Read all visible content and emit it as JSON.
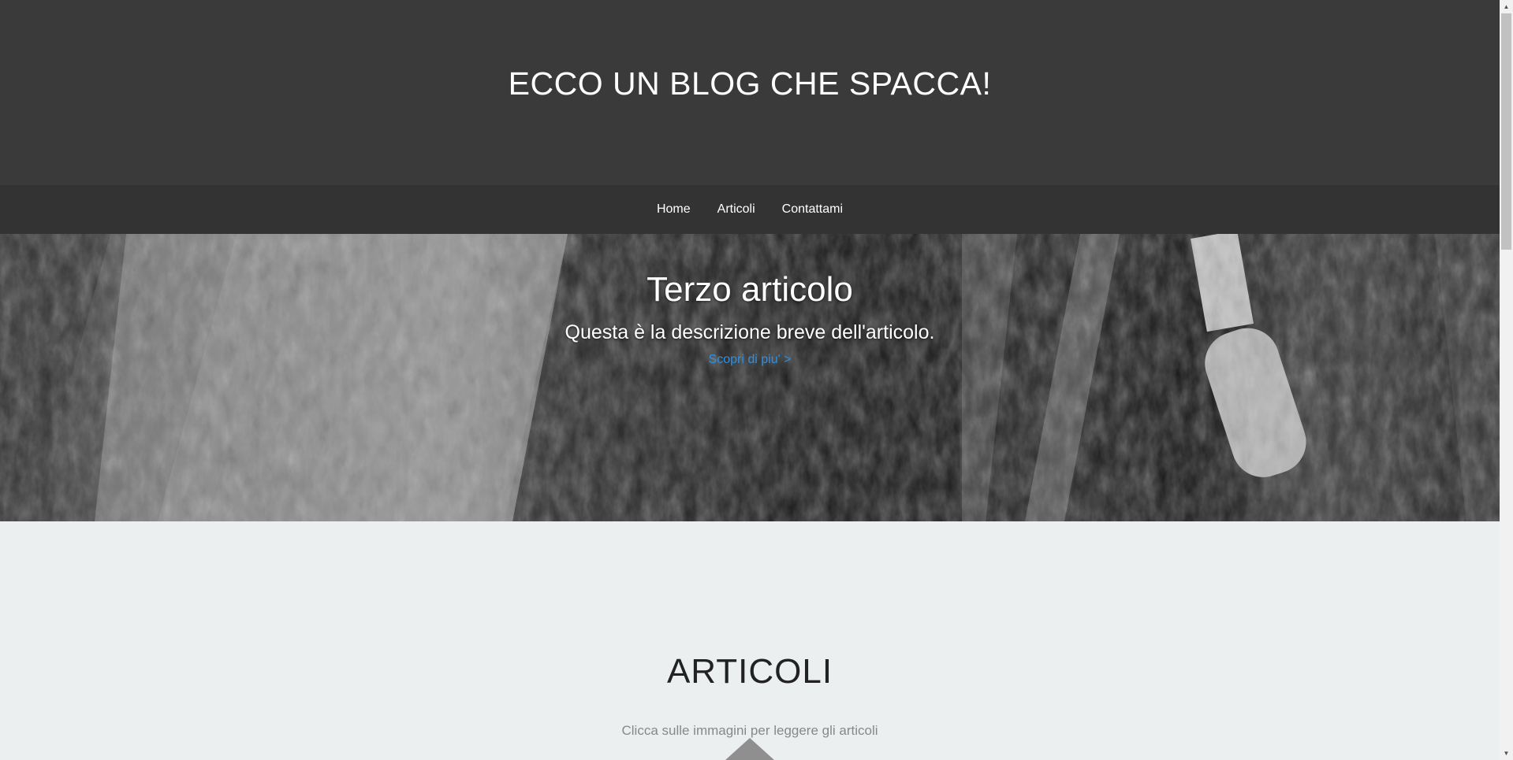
{
  "header": {
    "title": "ECCO UN BLOG CHE SPACCA!"
  },
  "nav": {
    "items": [
      {
        "label": "Home"
      },
      {
        "label": "Articoli"
      },
      {
        "label": "Contattami"
      }
    ]
  },
  "hero": {
    "title": "Terzo articolo",
    "description": "Questa è la descrizione breve dell'articolo.",
    "link_label": "Scopri di piu' >",
    "link_color": "#2f8fe0"
  },
  "articles": {
    "title": "ARTICOLI",
    "subtitle": "Clicca sulle immagini per leggere gli articoli"
  },
  "colors": {
    "header_bg": "#3a3a3b",
    "nav_bg": "#333334",
    "section_bg": "#eceff0"
  },
  "scrollbar": {
    "up_icon": "triangle-up-icon",
    "down_icon": "triangle-down-icon"
  }
}
